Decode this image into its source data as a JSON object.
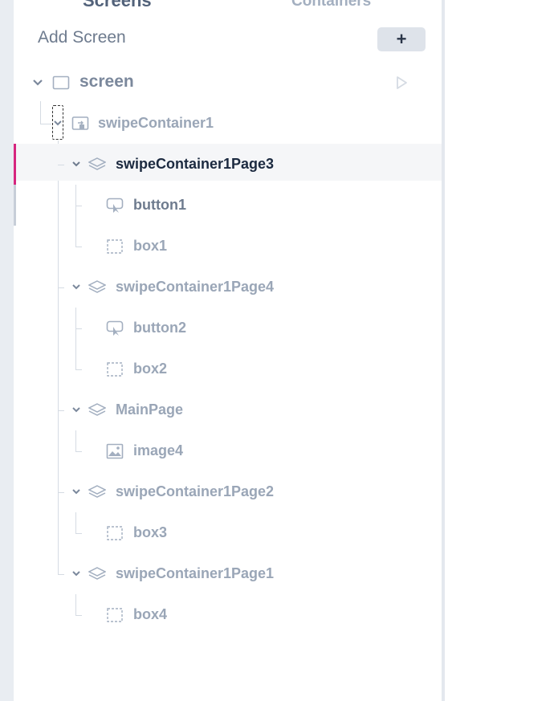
{
  "tabs": {
    "screens": "Screens",
    "containers": "Containers"
  },
  "add_screen": {
    "label": "Add Screen",
    "button": "+"
  },
  "tree": {
    "screen": "screen",
    "swipe_container": "swipeContainer1",
    "pages": [
      {
        "label": "swipeContainer1Page3",
        "children": [
          "button1",
          "box1"
        ]
      },
      {
        "label": "swipeContainer1Page4",
        "children": [
          "button2",
          "box2"
        ]
      },
      {
        "label": "MainPage",
        "children": [
          "image4"
        ]
      },
      {
        "label": "swipeContainer1Page2",
        "children": [
          "box3"
        ]
      },
      {
        "label": "swipeContainer1Page1",
        "children": [
          "box4"
        ]
      }
    ]
  },
  "icons": {
    "screen": "screen-icon",
    "swipe": "swipe-container-icon",
    "page": "layers-icon",
    "button": "touch-button-icon",
    "box": "box-icon",
    "image": "image-icon",
    "play": "play-icon",
    "chevron": "chevron-down-icon"
  },
  "colors": {
    "accent": "#d6267f",
    "panel": "#ffffff",
    "background": "#e9edf2"
  }
}
